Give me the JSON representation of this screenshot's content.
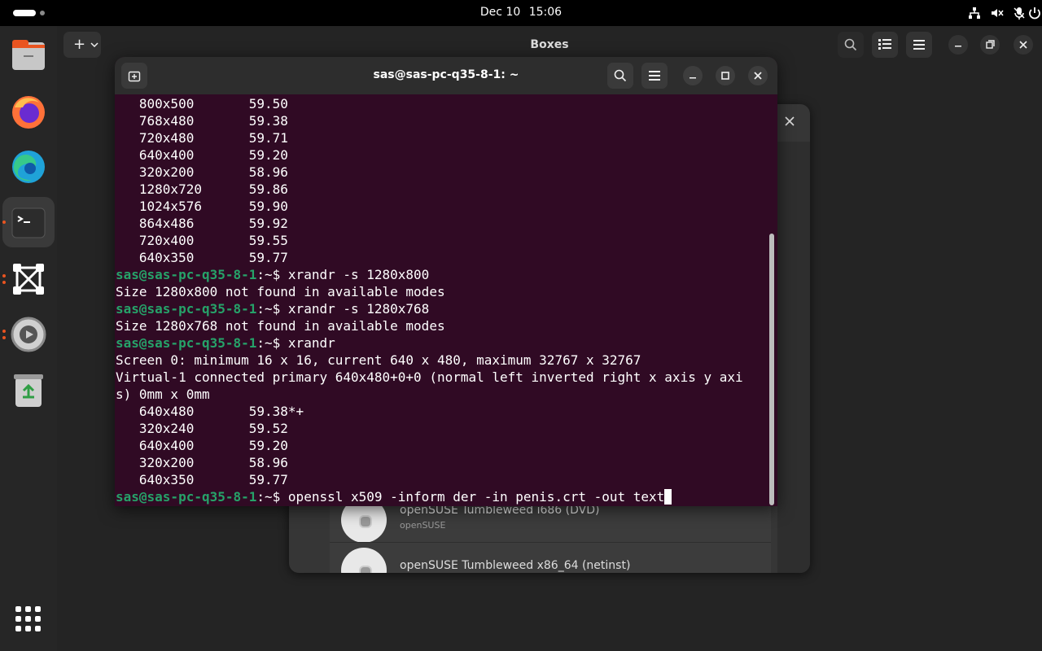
{
  "topbar": {
    "date": "Dec 10",
    "time": "15:06"
  },
  "icons": {
    "network": "network-icon",
    "mute": "speaker-muted-icon",
    "mic": "microphone-icon",
    "power": "power-icon"
  },
  "dock": {
    "items": [
      "files",
      "firefox",
      "edge",
      "terminal",
      "boxes",
      "settings",
      "trash"
    ],
    "app_grid": "app-grid-icon"
  },
  "boxes": {
    "title": "Boxes",
    "new_label": "+",
    "os_list": [
      {
        "name": "openSUSE Tumbleweed i686 (DVD)",
        "vendor": "openSUSE"
      },
      {
        "name": "openSUSE Tumbleweed x86_64 (netinst)",
        "vendor": ""
      }
    ]
  },
  "terminal": {
    "title": "sas@sas-pc-q35-8-1: ~",
    "prompt": "sas@sas-pc-q35-8-1",
    "prompt_suffix": ":~$ ",
    "lines": [
      {
        "type": "out",
        "text": "   800x500       59.50"
      },
      {
        "type": "out",
        "text": "   768x480       59.38"
      },
      {
        "type": "out",
        "text": "   720x480       59.71"
      },
      {
        "type": "out",
        "text": "   640x400       59.20"
      },
      {
        "type": "out",
        "text": "   320x200       58.96"
      },
      {
        "type": "out",
        "text": "   1280x720      59.86"
      },
      {
        "type": "out",
        "text": "   1024x576      59.90"
      },
      {
        "type": "out",
        "text": "   864x486       59.92"
      },
      {
        "type": "out",
        "text": "   720x400       59.55"
      },
      {
        "type": "out",
        "text": "   640x350       59.77"
      },
      {
        "type": "cmd",
        "text": "xrandr -s 1280x800"
      },
      {
        "type": "out",
        "text": "Size 1280x800 not found in available modes"
      },
      {
        "type": "cmd",
        "text": "xrandr -s 1280x768"
      },
      {
        "type": "out",
        "text": "Size 1280x768 not found in available modes"
      },
      {
        "type": "cmd",
        "text": "xrandr"
      },
      {
        "type": "out",
        "text": "Screen 0: minimum 16 x 16, current 640 x 480, maximum 32767 x 32767"
      },
      {
        "type": "out",
        "text": "Virtual-1 connected primary 640x480+0+0 (normal left inverted right x axis y axi"
      },
      {
        "type": "out",
        "text": "s) 0mm x 0mm"
      },
      {
        "type": "out",
        "text": "   640x480       59.38*+"
      },
      {
        "type": "out",
        "text": "   320x240       59.52"
      },
      {
        "type": "out",
        "text": "   640x400       59.20"
      },
      {
        "type": "out",
        "text": "   320x200       58.96"
      },
      {
        "type": "out",
        "text": "   640x350       59.77"
      },
      {
        "type": "cmd",
        "text": "openssl x509 -inform der -in penis.crt -out text",
        "cursor": true
      }
    ]
  },
  "colors": {
    "terminal_bg": "#300a24",
    "prompt_green": "#26a269",
    "accent_orange": "#e95420"
  }
}
